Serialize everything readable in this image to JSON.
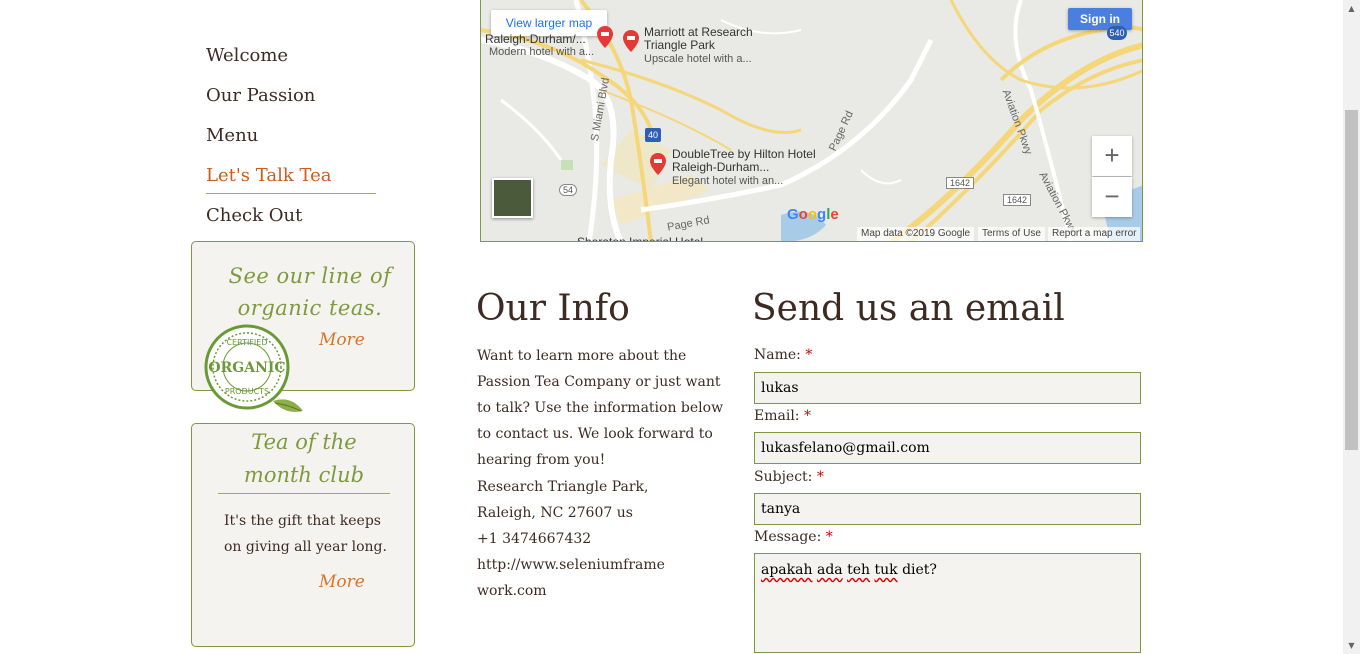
{
  "nav": {
    "items": [
      {
        "label": "Welcome"
      },
      {
        "label": "Our Passion"
      },
      {
        "label": "Menu"
      },
      {
        "label": "Let's Talk Tea"
      },
      {
        "label": "Check Out"
      }
    ],
    "active_index": 3
  },
  "sidebar": {
    "organic_card": {
      "title": "See our line of organic teas.",
      "more": "More",
      "seal": {
        "top": "CERTIFIED",
        "middle": "ORGANIC",
        "bottom": "PRODUCTS"
      }
    },
    "club_card": {
      "title": "Tea of the month club",
      "text": "It's the gift that keeps on giving all year long.",
      "more": "More"
    }
  },
  "map": {
    "larger_map": "View larger map",
    "sign_in": "Sign in",
    "zoom_in": "+",
    "zoom_out": "−",
    "google": "Google",
    "data_credit": "Map data ©2019 Google",
    "terms": "Terms of Use",
    "report": "Report a map error",
    "places": [
      {
        "name": "Raleigh-Durham/...",
        "sub": "Modern hotel with a..."
      },
      {
        "name": "Marriott at Research Triangle Park",
        "sub": "Upscale hotel with a..."
      },
      {
        "name": "DoubleTree by Hilton Hotel Raleigh-Durham...",
        "sub": "Elegant hotel with an..."
      },
      {
        "name": "Sheraton Imperial Hotel",
        "sub": ""
      }
    ],
    "road_labels": {
      "s_miami": "S Miami Blvd",
      "page_rd": "Page Rd",
      "page_rd2": "Page Rd",
      "aviation": "Aviation Pkwy",
      "aviation2": "Aviation Pkwy",
      "i40": "40",
      "r54": "54",
      "r540": "540",
      "r1642a": "1642",
      "r1642b": "1642"
    }
  },
  "info": {
    "title": "Our Info",
    "text": "Want to learn more about the Passion Tea Company or just want to talk? Use the information below to contact us. We look forward to hearing from you!",
    "address_line1": "Research Triangle Park,",
    "address_line2": "Raleigh, NC 27607 us",
    "phone": "+1 3474667432",
    "website": "http://www.seleniumframework.com"
  },
  "form": {
    "title": "Send us an email",
    "required_mark": "*",
    "name_label": "Name:",
    "name_value": "lukas",
    "email_label": "Email:",
    "email_value": "lukasfelano@gmail.com",
    "subject_label": "Subject:",
    "subject_value": "tanya",
    "message_label": "Message:",
    "message_words": [
      "apakah",
      "ada",
      "teh",
      "tuk",
      "diet?"
    ]
  },
  "colors": {
    "accent_green": "#7d9a3e",
    "active_orange": "#c95d1c",
    "more_orange": "#d9752a",
    "text_brown": "#3d2b23"
  }
}
